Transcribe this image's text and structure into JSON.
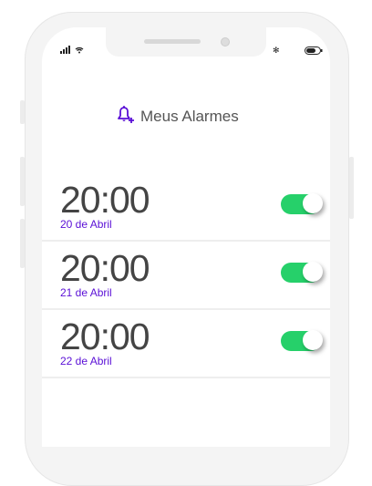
{
  "header": {
    "title": "Meus Alarmes",
    "icon": "bell-plus-icon"
  },
  "colors": {
    "accent": "#5a0fd6",
    "toggle_on": "#26d06a"
  },
  "alarms": [
    {
      "time": "20:00",
      "date": "20 de Abril",
      "enabled": true
    },
    {
      "time": "20:00",
      "date": "21 de Abril",
      "enabled": true
    },
    {
      "time": "20:00",
      "date": "22 de Abril",
      "enabled": true
    }
  ]
}
